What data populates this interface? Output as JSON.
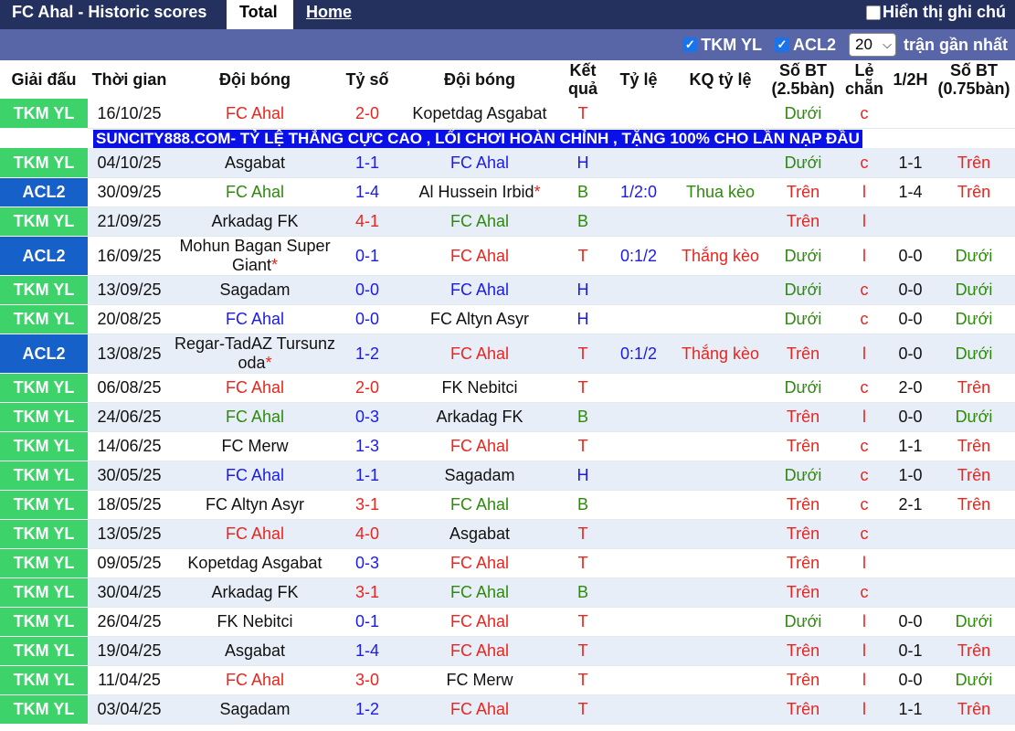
{
  "header": {
    "title": "FC Ahal - Historic scores",
    "tabs": [
      "Total",
      "Home"
    ],
    "history_label": "Hiển thị ghi chú"
  },
  "filters": {
    "league1": "TKM YL",
    "league2": "ACL2",
    "count": "20",
    "count_suffix": "trận gần nhất"
  },
  "columns": [
    "Giải đấu",
    "Thời gian",
    "Đội bóng",
    "Tỷ số",
    "Đội bóng",
    "Kết quả",
    "Tỷ lệ",
    "KQ tỷ lệ",
    "Số BT (2.5bàn)",
    "Lẻ chẵn",
    "1/2H",
    "Số BT (0.75bàn)"
  ],
  "ad_banner": "SUNCITY888.COM- TỶ LỆ THẮNG CỰC CAO , LỐI CHƠI HOÀN CHỈNH , TẶNG 100% CHO LẦN NẠP ĐẦU",
  "colors": {
    "tkm": "#3dd26a",
    "acl": "#1660c9",
    "red": "#e8251e",
    "blue": "#1b1be8",
    "green": "#2d8a0c"
  },
  "rows": [
    {
      "league": "TKM YL",
      "date": "16/10/25",
      "home": "FC Ahal",
      "score": "2-0",
      "away": "Kopetdag Asgabat",
      "res": "T",
      "odds": "",
      "oddres": "",
      "bt": "Dưới",
      "lc": "c",
      "half": "",
      "bt2": ""
    },
    {
      "league": "TKM YL",
      "date": "04/10/25",
      "home": "Asgabat",
      "score": "1-1",
      "away": "FC Ahal",
      "res": "H",
      "odds": "",
      "oddres": "",
      "bt": "Dưới",
      "lc": "c",
      "half": "1-1",
      "bt2": "Trên"
    },
    {
      "league": "ACL2",
      "date": "30/09/25",
      "home": "FC Ahal",
      "score": "1-4",
      "away": "Al Hussein Irbid",
      "res": "B",
      "odds": "1/2:0",
      "oddres": "Thua kèo",
      "bt": "Trên",
      "lc": "l",
      "half": "1-4",
      "bt2": "Trên"
    },
    {
      "league": "TKM YL",
      "date": "21/09/25",
      "home": "Arkadag FK",
      "score": "4-1",
      "away": "FC Ahal",
      "res": "B",
      "odds": "",
      "oddres": "",
      "bt": "Trên",
      "lc": "l",
      "half": "",
      "bt2": ""
    },
    {
      "league": "ACL2",
      "date": "16/09/25",
      "home": "Mohun Bagan Super Giant",
      "score": "0-1",
      "away": "FC Ahal",
      "res": "T",
      "odds": "0:1/2",
      "oddres": "Thắng kèo",
      "bt": "Dưới",
      "lc": "l",
      "half": "0-0",
      "bt2": "Dưới"
    },
    {
      "league": "TKM YL",
      "date": "13/09/25",
      "home": "Sagadam",
      "score": "0-0",
      "away": "FC Ahal",
      "res": "H",
      "odds": "",
      "oddres": "",
      "bt": "Dưới",
      "lc": "c",
      "half": "0-0",
      "bt2": "Dưới"
    },
    {
      "league": "TKM YL",
      "date": "20/08/25",
      "home": "FC Ahal",
      "score": "0-0",
      "away": "FC Altyn Asyr",
      "res": "H",
      "odds": "",
      "oddres": "",
      "bt": "Dưới",
      "lc": "c",
      "half": "0-0",
      "bt2": "Dưới"
    },
    {
      "league": "ACL2",
      "date": "13/08/25",
      "home": "Regar-TadAZ Tursunzoda",
      "score": "1-2",
      "away": "FC Ahal",
      "res": "T",
      "odds": "0:1/2",
      "oddres": "Thắng kèo",
      "bt": "Trên",
      "lc": "l",
      "half": "0-0",
      "bt2": "Dưới"
    },
    {
      "league": "TKM YL",
      "date": "06/08/25",
      "home": "FC Ahal",
      "score": "2-0",
      "away": "FK Nebitci",
      "res": "T",
      "odds": "",
      "oddres": "",
      "bt": "Dưới",
      "lc": "c",
      "half": "2-0",
      "bt2": "Trên"
    },
    {
      "league": "TKM YL",
      "date": "24/06/25",
      "home": "FC Ahal",
      "score": "0-3",
      "away": "Arkadag FK",
      "res": "B",
      "odds": "",
      "oddres": "",
      "bt": "Trên",
      "lc": "l",
      "half": "0-0",
      "bt2": "Dưới"
    },
    {
      "league": "TKM YL",
      "date": "14/06/25",
      "home": "FC Merw",
      "score": "1-3",
      "away": "FC Ahal",
      "res": "T",
      "odds": "",
      "oddres": "",
      "bt": "Trên",
      "lc": "c",
      "half": "1-1",
      "bt2": "Trên"
    },
    {
      "league": "TKM YL",
      "date": "30/05/25",
      "home": "FC Ahal",
      "score": "1-1",
      "away": "Sagadam",
      "res": "H",
      "odds": "",
      "oddres": "",
      "bt": "Dưới",
      "lc": "c",
      "half": "1-0",
      "bt2": "Trên"
    },
    {
      "league": "TKM YL",
      "date": "18/05/25",
      "home": "FC Altyn Asyr",
      "score": "3-1",
      "away": "FC Ahal",
      "res": "B",
      "odds": "",
      "oddres": "",
      "bt": "Trên",
      "lc": "c",
      "half": "2-1",
      "bt2": "Trên"
    },
    {
      "league": "TKM YL",
      "date": "13/05/25",
      "home": "FC Ahal",
      "score": "4-0",
      "away": "Asgabat",
      "res": "T",
      "odds": "",
      "oddres": "",
      "bt": "Trên",
      "lc": "c",
      "half": "",
      "bt2": ""
    },
    {
      "league": "TKM YL",
      "date": "09/05/25",
      "home": "Kopetdag Asgabat",
      "score": "0-3",
      "away": "FC Ahal",
      "res": "T",
      "odds": "",
      "oddres": "",
      "bt": "Trên",
      "lc": "l",
      "half": "",
      "bt2": ""
    },
    {
      "league": "TKM YL",
      "date": "30/04/25",
      "home": "Arkadag FK",
      "score": "3-1",
      "away": "FC Ahal",
      "res": "B",
      "odds": "",
      "oddres": "",
      "bt": "Trên",
      "lc": "c",
      "half": "",
      "bt2": ""
    },
    {
      "league": "TKM YL",
      "date": "26/04/25",
      "home": "FK Nebitci",
      "score": "0-1",
      "away": "FC Ahal",
      "res": "T",
      "odds": "",
      "oddres": "",
      "bt": "Dưới",
      "lc": "l",
      "half": "0-0",
      "bt2": "Dưới"
    },
    {
      "league": "TKM YL",
      "date": "19/04/25",
      "home": "Asgabat",
      "score": "1-4",
      "away": "FC Ahal",
      "res": "T",
      "odds": "",
      "oddres": "",
      "bt": "Trên",
      "lc": "l",
      "half": "0-1",
      "bt2": "Trên"
    },
    {
      "league": "TKM YL",
      "date": "11/04/25",
      "home": "FC Ahal",
      "score": "3-0",
      "away": "FC Merw",
      "res": "T",
      "odds": "",
      "oddres": "",
      "bt": "Trên",
      "lc": "l",
      "half": "0-0",
      "bt2": "Dưới"
    },
    {
      "league": "TKM YL",
      "date": "03/04/25",
      "home": "Sagadam",
      "score": "1-2",
      "away": "FC Ahal",
      "res": "T",
      "odds": "",
      "oddres": "",
      "bt": "Trên",
      "lc": "l",
      "half": "1-1",
      "bt2": "Trên"
    }
  ]
}
